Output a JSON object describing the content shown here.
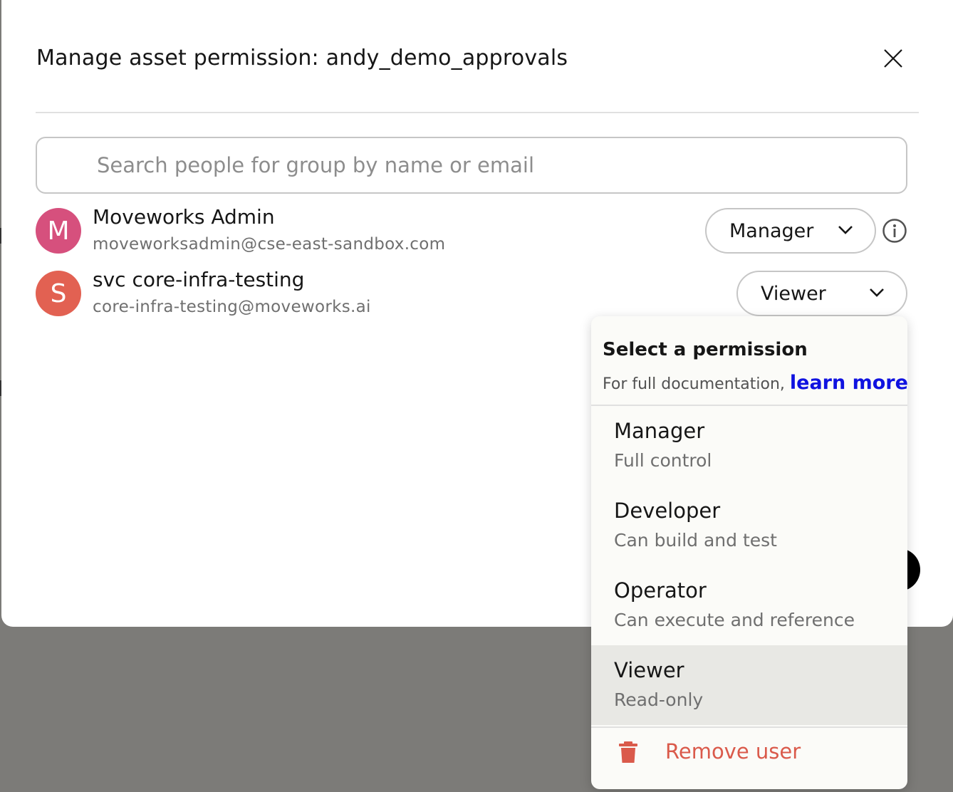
{
  "modal": {
    "title": "Manage asset permission: andy_demo_approvals",
    "close_icon": "close-icon"
  },
  "search": {
    "placeholder": "Search people for group by name or email",
    "value": ""
  },
  "users": [
    {
      "initial": "M",
      "name": "Moveworks Admin",
      "email": "moveworksadmin@cse-east-sandbox.com",
      "permission": "Manager",
      "avatar_color": "#d6507d"
    },
    {
      "initial": "S",
      "name": "svc core-infra-testing",
      "email": "core-infra-testing@moveworks.ai",
      "permission": "Viewer",
      "avatar_color": "#e26152"
    }
  ],
  "permission_menu": {
    "heading": "Select a permission",
    "doc_prefix": "For full documentation,",
    "doc_link": "learn more",
    "options": [
      {
        "title": "Manager",
        "description": "Full control"
      },
      {
        "title": "Developer",
        "description": "Can build and test"
      },
      {
        "title": "Operator",
        "description": "Can execute and reference"
      },
      {
        "title": "Viewer",
        "description": "Read-only"
      }
    ],
    "selected": "Viewer",
    "remove_label": "Remove user"
  },
  "colors": {
    "link": "#0f12e0",
    "danger": "#da5a4b",
    "selected_bg": "#e8e8e4",
    "overlay": "#7c7b78"
  }
}
